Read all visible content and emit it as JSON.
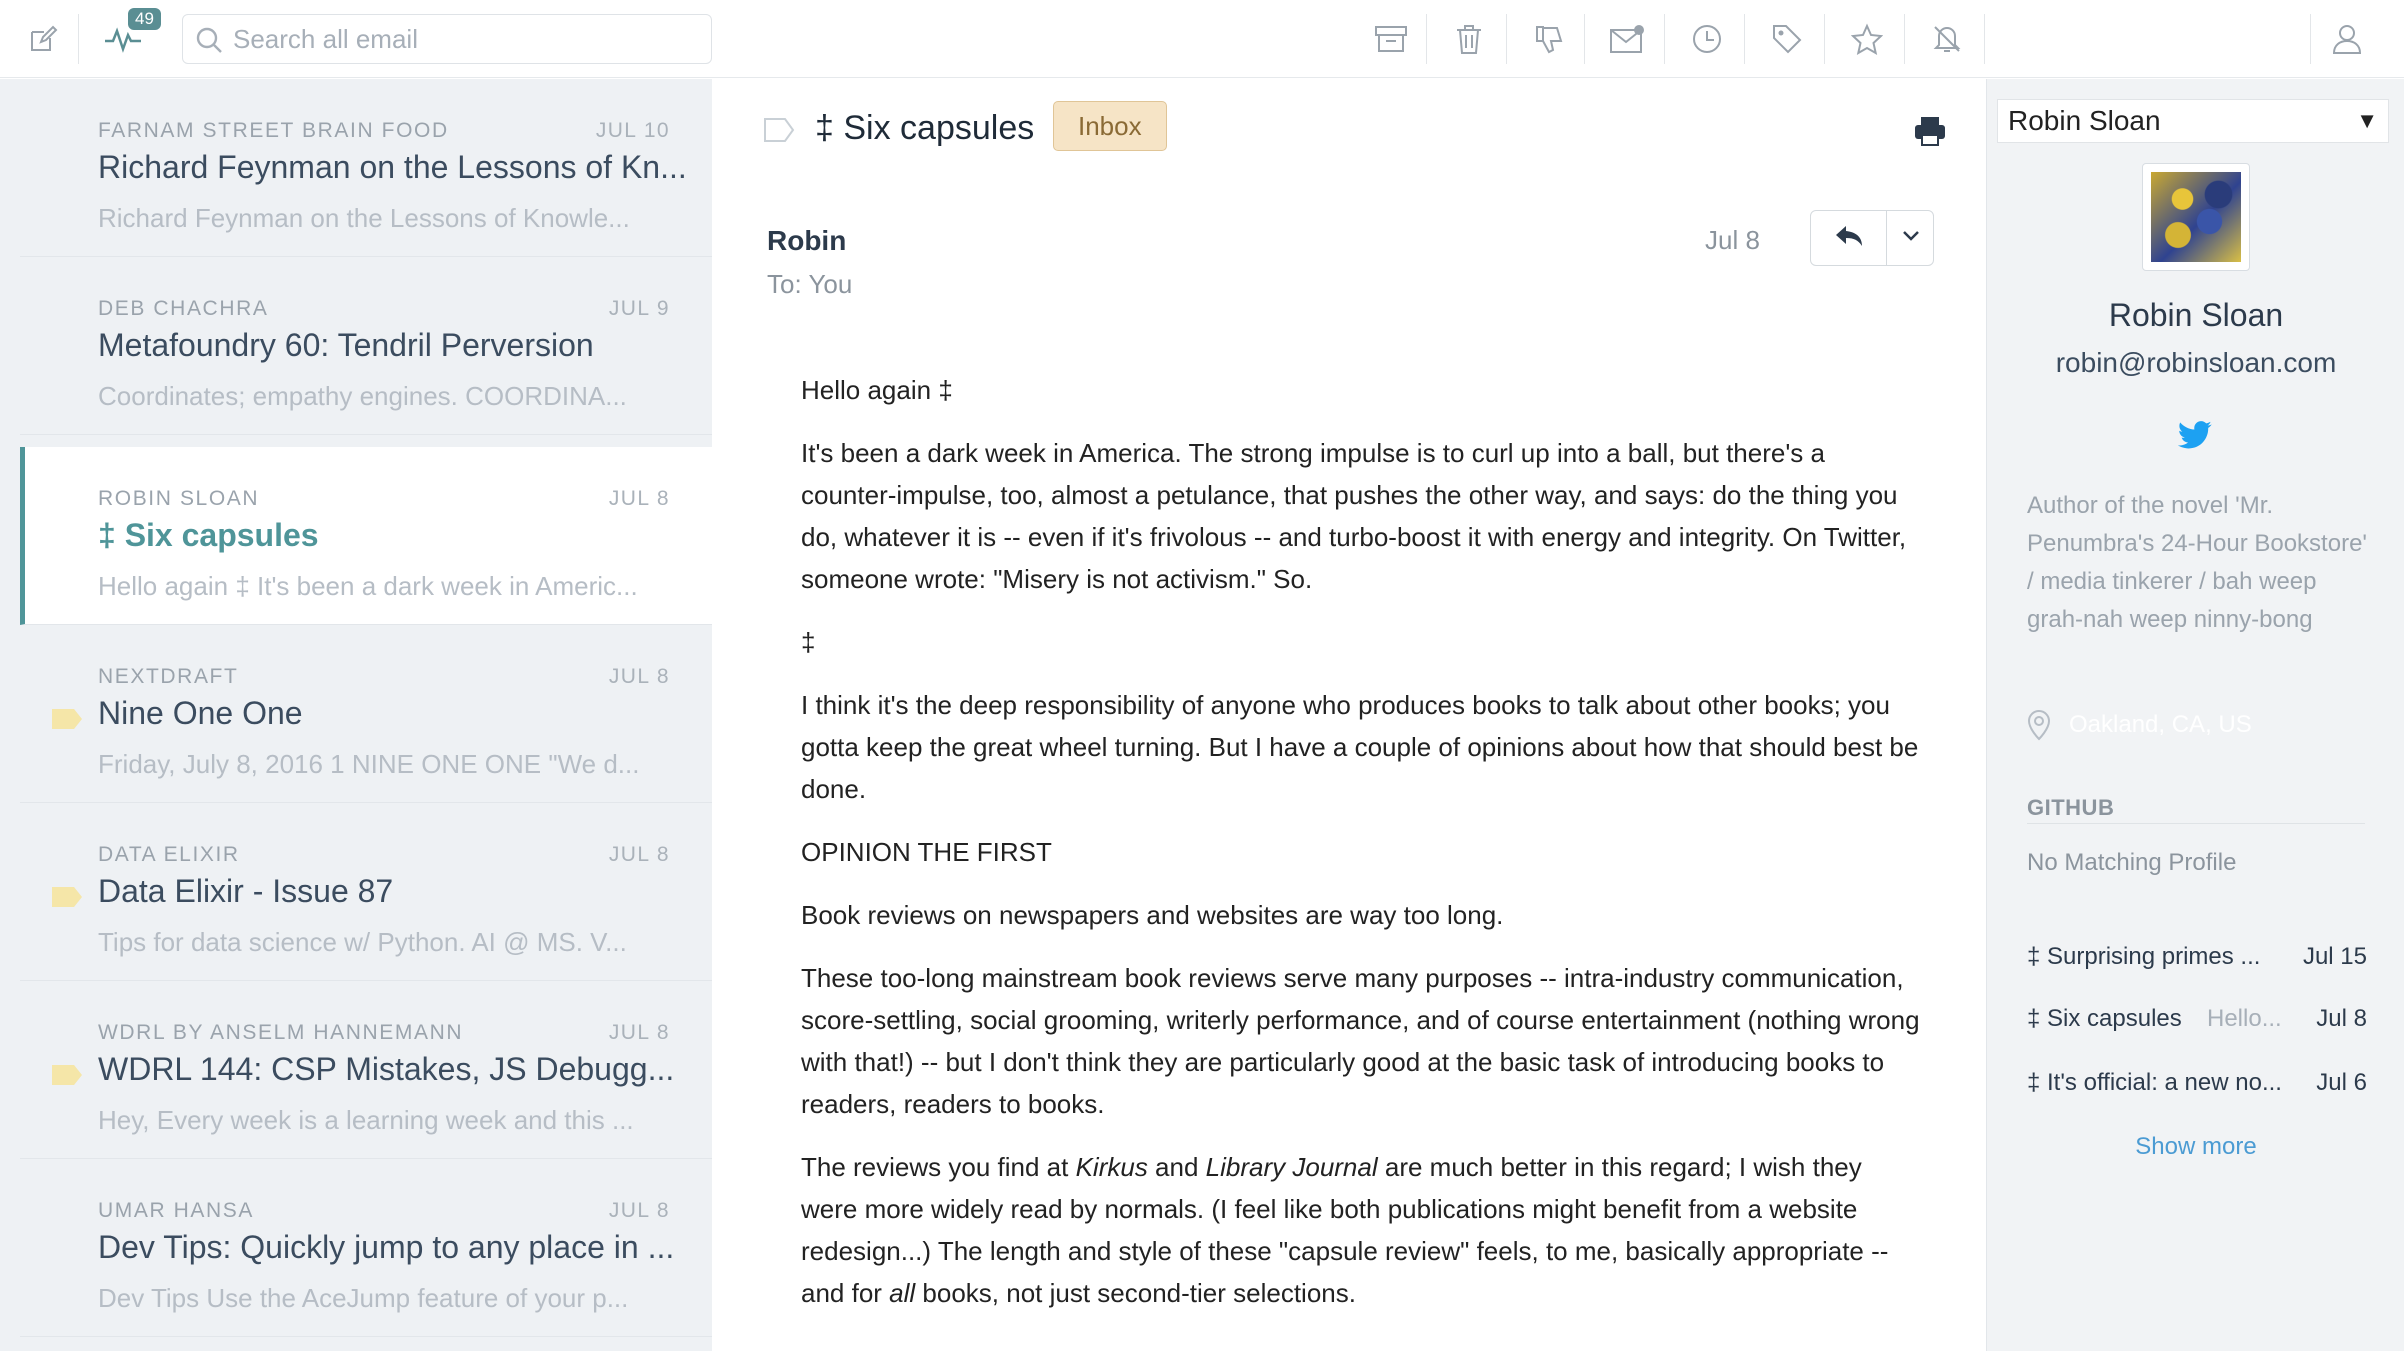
{
  "toolbar": {
    "unread_count": "49",
    "search_placeholder": "Search all email"
  },
  "messages": [
    {
      "sender": "FARNAM STREET BRAIN FOOD",
      "date": "JUL 10",
      "subject": "Richard Feynman on the Lessons of Kn...",
      "snippet": "Richard Feynman on the Lessons of Knowle..."
    },
    {
      "sender": "DEB CHACHRA",
      "date": "JUL 9",
      "subject": "Metafoundry 60: Tendril Perversion",
      "snippet": "Coordinates; empathy engines. COORDINA..."
    },
    {
      "sender": "ROBIN SLOAN",
      "date": "JUL 8",
      "subject": "‡ Six capsules",
      "snippet": "Hello again ‡ It's been a dark week in Americ..."
    },
    {
      "sender": "NEXTDRAFT",
      "date": "JUL 8",
      "subject": "Nine One One",
      "snippet": "Friday, July 8, 2016 1 NINE ONE ONE \"We d..."
    },
    {
      "sender": "DATA ELIXIR",
      "date": "JUL 8",
      "subject": "Data Elixir - Issue 87",
      "snippet": "Tips for data science w/ Python. AI @ MS. V..."
    },
    {
      "sender": "WDRL BY ANSELM HANNEMANN",
      "date": "JUL 8",
      "subject": "WDRL 144: CSP Mistakes, JS Debugg...",
      "snippet": "Hey, Every week is a learning week and this ..."
    },
    {
      "sender": "UMAR HANSA",
      "date": "JUL 8",
      "subject": "Dev Tips: Quickly jump to any place in ...",
      "snippet": "Dev Tips Use the AceJump feature of your p..."
    }
  ],
  "email": {
    "title": "‡ Six capsules",
    "label": "Inbox",
    "from": "Robin",
    "to": "To: You",
    "date": "Jul 8",
    "greeting": "Hello again ‡",
    "para1": "It's been a dark week in America. The strong impulse is to curl up into a ball, but there's a counter-impulse, too, almost a petulance, that pushes the other way, and says: do the thing you do, whatever it is -- even if it's frivolous -- and turbo-boost it with energy and integrity. On Twitter, someone wrote: \"Misery is not activism.\" So.",
    "divider": "‡",
    "para2": "I think it's the deep responsibility of anyone who produces books to talk about other books; you gotta keep the great wheel turning. But I have a couple of opinions about how that should best be done.",
    "heading": "OPINION THE FIRST",
    "para3": "Book reviews on newspapers and websites are way too long.",
    "para4": "These too-long mainstream book reviews serve many purposes -- intra-industry communication, score-settling, social grooming, writerly performance, and of course entertainment (nothing wrong with that!) -- but I don't think they are particularly good at the basic task of introducing books to readers, readers to books.",
    "para5_a": "The reviews you find at ",
    "para5_kirkus": "Kirkus",
    "para5_b": " and ",
    "para5_lj": "Library Journal",
    "para5_c": " are much better in this regard; I wish they were more widely read by normals. (I feel like both publications might benefit from a website redesign...) The length and style of these \"capsule review\" feels, to me, basically appropriate -- and for ",
    "para5_all": "all",
    "para5_d": " books, not just second-tier selections."
  },
  "contact": {
    "selector": "Robin Sloan",
    "name": "Robin Sloan",
    "email": "robin@robinsloan.com",
    "bio": "Author of the novel 'Mr. Penumbra's 24-Hour Bookstore' / media tinkerer / bah weep grah-nah weep ninny-bong",
    "location": "Oakland, CA, US",
    "github_heading": "GITHUB",
    "github_text": "No Matching Profile",
    "threads": [
      {
        "title": "‡ Surprising primes ...",
        "snippet": "",
        "date": "Jul 15"
      },
      {
        "title": "‡ Six capsules",
        "snippet": "Hello...",
        "date": "Jul 8"
      },
      {
        "title": "‡ It's official: a new no...",
        "snippet": "",
        "date": "Jul 6"
      }
    ],
    "show_more": "Show more"
  },
  "colors": {
    "accent": "#4f9599",
    "label_bg": "#f6e4c6",
    "twitter": "#1da1f2",
    "link": "#4b9bd3",
    "tag_yellow": "#f5e6a8"
  },
  "icons": [
    "compose-icon",
    "activity-icon",
    "search-icon",
    "archive-icon",
    "trash-icon",
    "thumbs-down-icon",
    "envelope-icon",
    "clock-icon",
    "tag-icon",
    "star-icon",
    "mute-icon",
    "person-icon",
    "print-icon",
    "reply-icon",
    "chevron-down-icon",
    "twitter-icon",
    "location-pin-icon"
  ]
}
